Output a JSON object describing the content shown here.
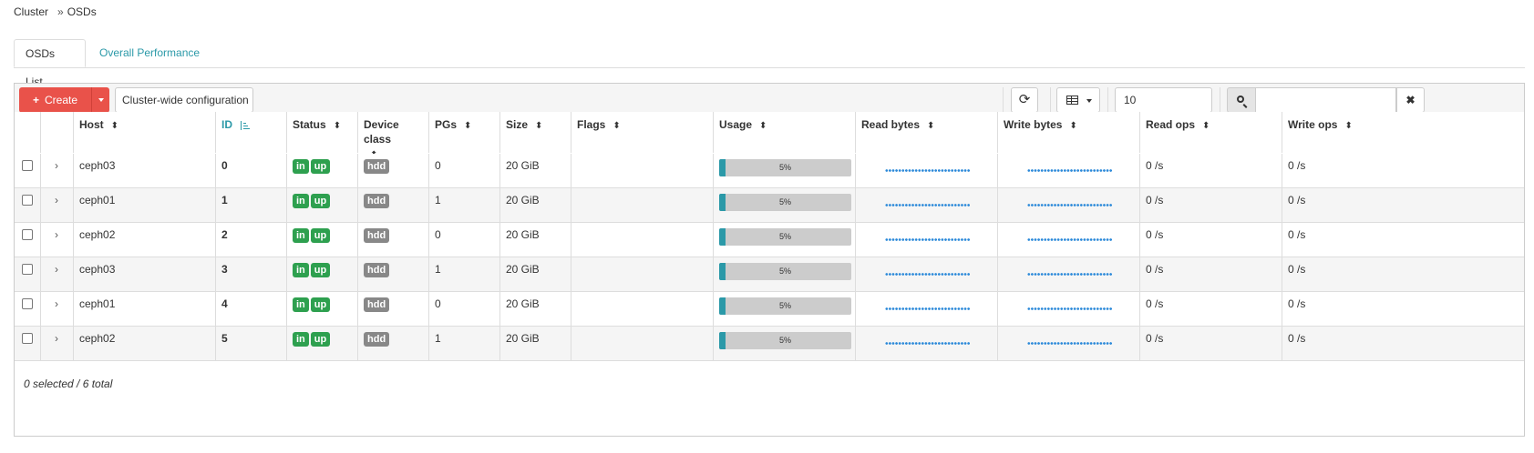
{
  "breadcrumb": {
    "root": "Cluster",
    "separator": "»",
    "current": "OSDs"
  },
  "tabs": [
    {
      "label": "OSDs List",
      "active": true
    },
    {
      "label": "Overall Performance",
      "active": false
    }
  ],
  "toolbar": {
    "create_label": "Create",
    "config_label": "Cluster-wide configuration",
    "page_size": "10",
    "search_placeholder": "",
    "clear_label": "✖",
    "refresh_icon": "refresh-icon",
    "columns_icon": "table-icon"
  },
  "columns": [
    {
      "key": "host",
      "label": "Host"
    },
    {
      "key": "id",
      "label": "ID"
    },
    {
      "key": "status",
      "label": "Status"
    },
    {
      "key": "device_class",
      "label": "Device class"
    },
    {
      "key": "pgs",
      "label": "PGs"
    },
    {
      "key": "size",
      "label": "Size"
    },
    {
      "key": "flags",
      "label": "Flags"
    },
    {
      "key": "usage",
      "label": "Usage"
    },
    {
      "key": "read_bytes",
      "label": "Read bytes"
    },
    {
      "key": "write_bytes",
      "label": "Write bytes"
    },
    {
      "key": "read_ops",
      "label": "Read ops"
    },
    {
      "key": "write_ops",
      "label": "Write ops"
    }
  ],
  "sorted_column": "id",
  "rows": [
    {
      "host": "ceph03",
      "id": "0",
      "status": [
        "in",
        "up"
      ],
      "device_class": "hdd",
      "pgs": "0",
      "size": "20 GiB",
      "flags": "",
      "usage_label": "5%",
      "usage_fraction": 0.05,
      "read_ops": "0 /s",
      "write_ops": "0 /s"
    },
    {
      "host": "ceph01",
      "id": "1",
      "status": [
        "in",
        "up"
      ],
      "device_class": "hdd",
      "pgs": "1",
      "size": "20 GiB",
      "flags": "",
      "usage_label": "5%",
      "usage_fraction": 0.05,
      "read_ops": "0 /s",
      "write_ops": "0 /s"
    },
    {
      "host": "ceph02",
      "id": "2",
      "status": [
        "in",
        "up"
      ],
      "device_class": "hdd",
      "pgs": "0",
      "size": "20 GiB",
      "flags": "",
      "usage_label": "5%",
      "usage_fraction": 0.05,
      "read_ops": "0 /s",
      "write_ops": "0 /s"
    },
    {
      "host": "ceph03",
      "id": "3",
      "status": [
        "in",
        "up"
      ],
      "device_class": "hdd",
      "pgs": "1",
      "size": "20 GiB",
      "flags": "",
      "usage_label": "5%",
      "usage_fraction": 0.05,
      "read_ops": "0 /s",
      "write_ops": "0 /s"
    },
    {
      "host": "ceph01",
      "id": "4",
      "status": [
        "in",
        "up"
      ],
      "device_class": "hdd",
      "pgs": "0",
      "size": "20 GiB",
      "flags": "",
      "usage_label": "5%",
      "usage_fraction": 0.05,
      "read_ops": "0 /s",
      "write_ops": "0 /s"
    },
    {
      "host": "ceph02",
      "id": "5",
      "status": [
        "in",
        "up"
      ],
      "device_class": "hdd",
      "pgs": "1",
      "size": "20 GiB",
      "flags": "",
      "usage_label": "5%",
      "usage_fraction": 0.05,
      "read_ops": "0 /s",
      "write_ops": "0 /s"
    }
  ],
  "footer": "0 selected / 6 total",
  "colors": {
    "accent": "#2b99a8",
    "danger": "#e9524a",
    "success": "#2ea04f",
    "neutral_badge": "#888888",
    "sparkline": "#2b89d9"
  }
}
